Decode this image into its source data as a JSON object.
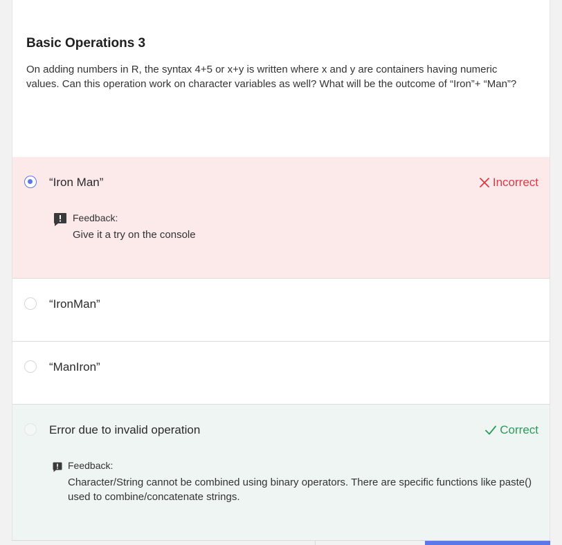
{
  "question": {
    "title": "Basic Operations 3",
    "body": "On adding numbers in R, the syntax 4+5 or x+y is written where x and y are containers having numeric values. Can this operation work on character variables as well? What will be the outcome of “Iron”+ “Man”?"
  },
  "options": [
    {
      "label": "“Iron Man”",
      "selected": true,
      "result": "Incorrect",
      "feedback_label": "Feedback:",
      "feedback_text": "Give it a try on the console"
    },
    {
      "label": "“IronMan”",
      "selected": false
    },
    {
      "label": "“ManIron”",
      "selected": false
    },
    {
      "label": "Error due to invalid operation",
      "selected": false,
      "result": "Correct",
      "feedback_label": "Feedback:",
      "feedback_text": "Character/String cannot be combined using binary operators. There are specific functions like paste() used to combine/concatenate strings."
    }
  ],
  "colors": {
    "incorrect": "#d93a44",
    "correct": "#2b9a5a",
    "accent": "#5a78e8",
    "incorrect_bg": "#fce9ea",
    "correct_bg": "#eef5f2"
  },
  "icons": {
    "incorrect": "x-icon",
    "correct": "check-icon",
    "feedback": "exclamation-speech-bubble-icon",
    "radio_selected": "radio-selected-icon",
    "radio_unselected": "radio-unselected-icon"
  }
}
